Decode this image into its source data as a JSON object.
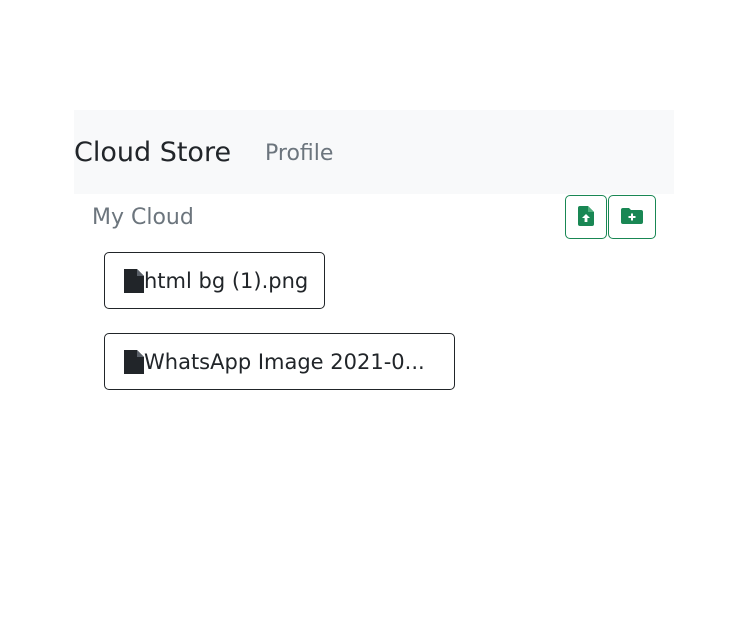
{
  "navbar": {
    "brand": "Cloud Store",
    "links": [
      {
        "label": "Profile"
      }
    ]
  },
  "breadcrumb": {
    "title": "My Cloud"
  },
  "toolbar": {
    "upload_icon": "file-upload-icon",
    "new_folder_icon": "folder-plus-icon",
    "accent_color": "#198754"
  },
  "files": [
    {
      "name": "html bg (1).png",
      "icon": "file-icon"
    },
    {
      "name": "WhatsApp Image 2021-0...",
      "icon": "file-icon"
    }
  ]
}
